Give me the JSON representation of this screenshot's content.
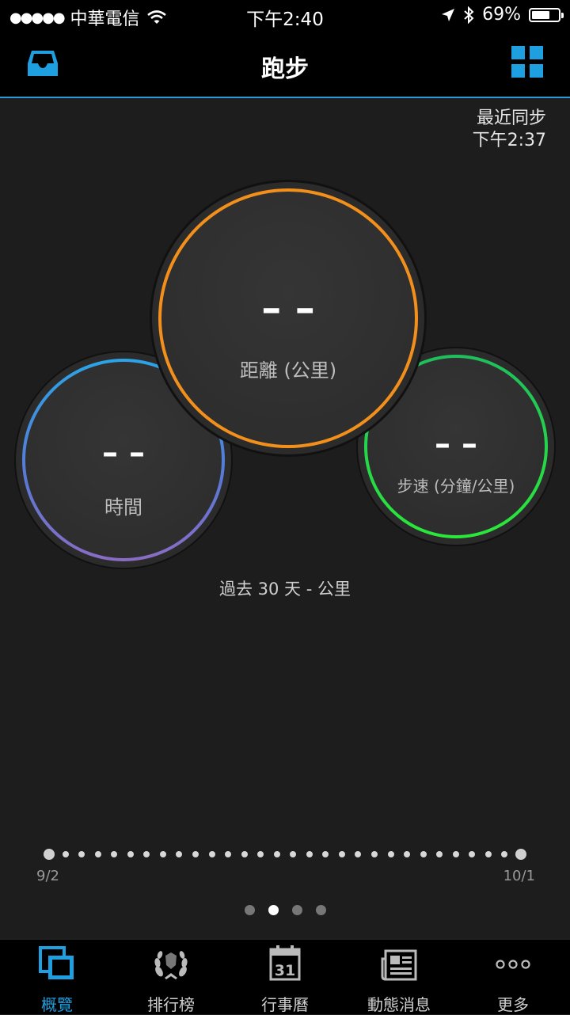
{
  "status_bar": {
    "carrier": "中華電信",
    "time": "下午2:40",
    "battery_percent": "69%",
    "battery_level": 0.69
  },
  "navbar": {
    "title": "跑步"
  },
  "sync": {
    "label": "最近同步",
    "time": "下午2:37"
  },
  "stats": {
    "distance": {
      "value": "– –",
      "label": "距離 (公里)",
      "ring_color": "#f3901c"
    },
    "time": {
      "value": "– –",
      "label": "時間",
      "ring_color": "#2ba4e6"
    },
    "pace": {
      "value": "– –",
      "label": "步速 (分鐘/公里)",
      "ring_color": "#22d84a"
    }
  },
  "period_label": "過去 30 天 - 公里",
  "timeline": {
    "start_label": "9/2",
    "end_label": "10/1",
    "dot_count": 30
  },
  "pager": {
    "pages": 4,
    "active_index": 1
  },
  "tabs": [
    {
      "label": "概覽",
      "icon": "overview-icon",
      "active": true
    },
    {
      "label": "排行榜",
      "icon": "laurel-icon",
      "active": false
    },
    {
      "label": "行事曆",
      "icon": "calendar-icon",
      "active": false,
      "icon_text": "31"
    },
    {
      "label": "動態消息",
      "icon": "newspaper-icon",
      "active": false
    },
    {
      "label": "更多",
      "icon": "more-icon",
      "active": false
    }
  ],
  "colors": {
    "accent": "#1e9fe0",
    "background": "#1d1d1d"
  }
}
